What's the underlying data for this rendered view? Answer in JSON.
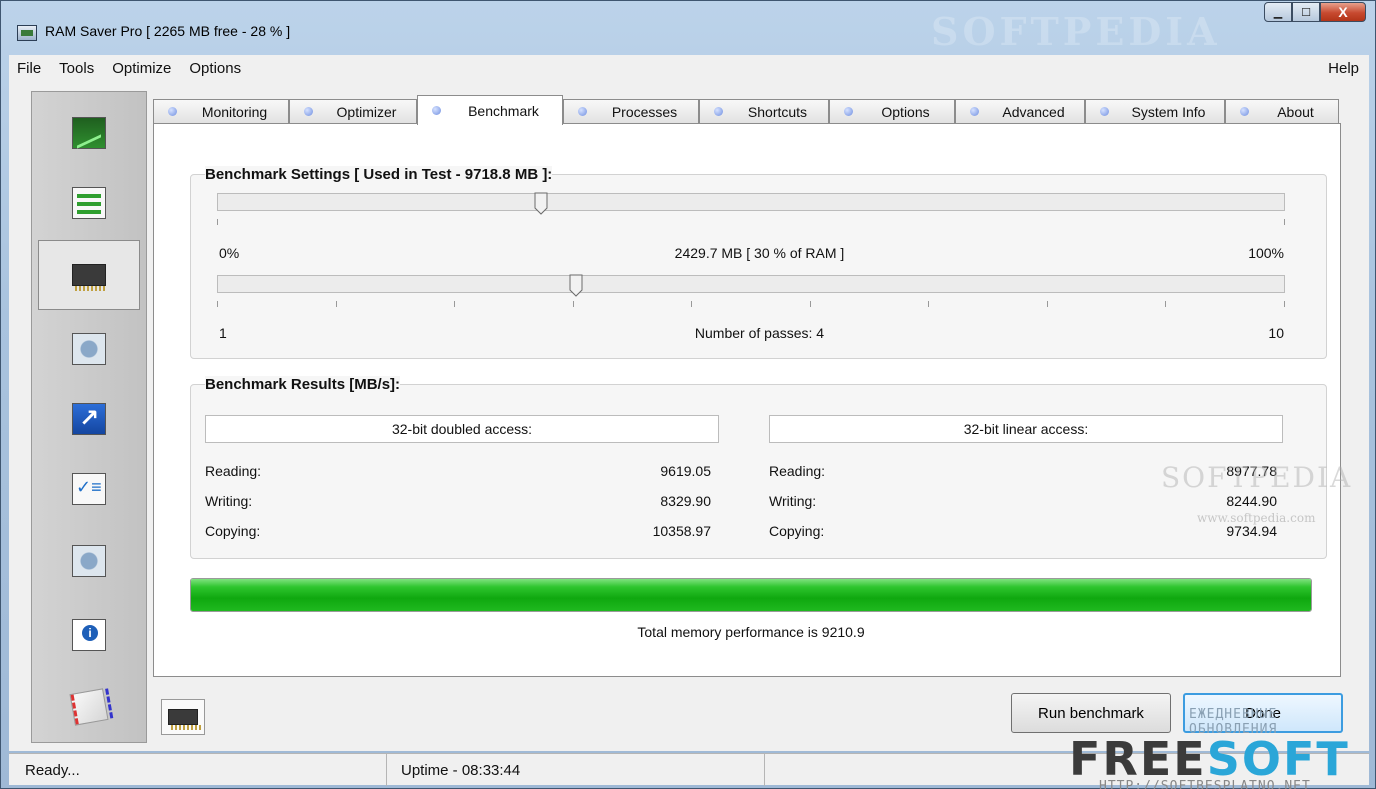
{
  "window": {
    "title": "RAM Saver Pro [ 2265 MB free - 28 % ]",
    "title_watermark": "SOFTPEDIA",
    "minimize_glyph": "▁",
    "maximize_glyph": "☐",
    "close_glyph": "X"
  },
  "menu": {
    "items": [
      "File",
      "Tools",
      "Optimize",
      "Options"
    ],
    "help": "Help"
  },
  "sidebar": {
    "items": [
      {
        "icon": "monitoring-chart-icon"
      },
      {
        "icon": "optimizer-bars-icon"
      },
      {
        "icon": "benchmark-chip-icon",
        "active": true
      },
      {
        "icon": "processes-gear-icon"
      },
      {
        "icon": "shortcuts-arrow-icon"
      },
      {
        "icon": "options-checklist-icon"
      },
      {
        "icon": "advanced-settings-icon"
      },
      {
        "icon": "about-info-icon"
      },
      {
        "icon": "mail-envelope-icon"
      }
    ]
  },
  "tabs": [
    "Monitoring",
    "Optimizer",
    "Benchmark",
    "Processes",
    "Shortcuts",
    "Options",
    "Advanced",
    "System Info",
    "About"
  ],
  "active_tab": "Benchmark",
  "benchmark": {
    "settings_title": "Benchmark Settings [ Used in Test - 9718.8 MB ]:",
    "memory_slider": {
      "min_label": "0%",
      "max_label": "100%",
      "value_label": "2429.7 MB [ 30 % of RAM ]",
      "value_fraction": 0.3
    },
    "passes_slider": {
      "min_label": "1",
      "max_label": "10",
      "value_label": "Number of passes: 4",
      "value": 4,
      "min": 1,
      "max": 10
    },
    "results_title": "Benchmark Results [MB/s]:",
    "doubled": {
      "header": "32-bit doubled access:",
      "reading_label": "Reading:",
      "reading": "9619.05",
      "writing_label": "Writing:",
      "writing": "8329.90",
      "copying_label": "Copying:",
      "copying": "10358.97"
    },
    "linear": {
      "header": "32-bit linear access:",
      "reading_label": "Reading:",
      "reading": "8977.78",
      "writing_label": "Writing:",
      "writing": "8244.90",
      "copying_label": "Copying:",
      "copying": "9734.94"
    },
    "progress_fraction": 1.0,
    "total_text": "Total memory performance is 9210.9"
  },
  "buttons": {
    "run": "Run benchmark",
    "done": "Done"
  },
  "status": {
    "left": "Ready...",
    "uptime": "Uptime - 08:33:44"
  },
  "watermarks": {
    "softpedia": "SOFTPEDIA",
    "softpedia_url": "www.softpedia.com",
    "freesoft_tagline": "ЕЖЕДНЕВНЫЕ ОБНОВЛЕНИЯ",
    "freesoft_a": "FREE",
    "freesoft_b": "SOFT",
    "freesoft_url": "HTTP://SOFTBESPLATNO.NET"
  },
  "colors": {
    "progress_green": "#0fa80f",
    "done_border": "#3c9ce0",
    "close_red": "#c74a30"
  }
}
